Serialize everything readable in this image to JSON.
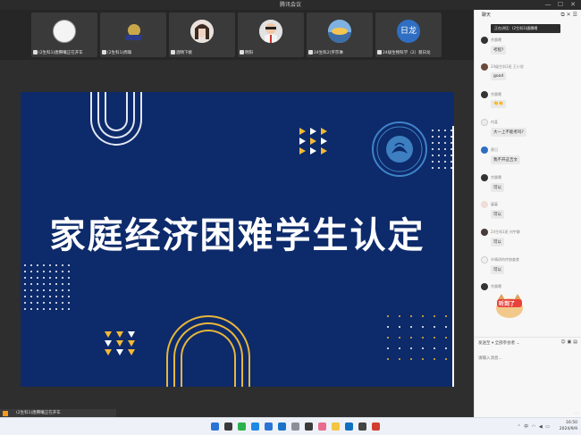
{
  "window": {
    "title": "腾讯会议",
    "minimize": "—",
    "maximize": "☐",
    "close": "✕"
  },
  "participants": [
    {
      "name": "(2生科1)唐腾曦正在开车",
      "avatar": "white-ball"
    },
    {
      "name": "(2生科1)周瑜",
      "avatar": "dog-photo"
    },
    {
      "name": "酒晴下桃",
      "avatar": "girl-photo"
    },
    {
      "name": "明阳",
      "avatar": "cartoon-man"
    },
    {
      "name": "24生科2)罗莎琳",
      "avatar": "scenery"
    },
    {
      "name": "24级生物科学（2）蔡日龙",
      "avatar": "text-avatar",
      "avatar_text": "日龙"
    }
  ],
  "slide": {
    "title": "家庭经济困难学生认定"
  },
  "bottom_status": {
    "label": "(2生科1)唐腾曦正在开车"
  },
  "chat": {
    "title": "聊天",
    "notice": "正在讲话：(2生科1)唐腾曦",
    "messages": [
      {
        "sender": "余晨曦",
        "text": "考程?"
      },
      {
        "sender": "24级生科1班 王小欣",
        "text": "good"
      },
      {
        "sender": "余晨曦",
        "text": "👏👏"
      },
      {
        "sender": "何某",
        "text": "大一上不能考吗?"
      },
      {
        "sender": "蔡日",
        "text": "我不开这吉文"
      },
      {
        "sender": "余晨曦",
        "text": "可以"
      },
      {
        "sender": "蔓蔓",
        "text": "可以"
      },
      {
        "sender": "24生科1班 刘宇静",
        "text": "可以"
      },
      {
        "sender": "许晴玥的传统美食",
        "text": "可以"
      },
      {
        "sender": "余晨曦",
        "sticker_text": "听到了"
      }
    ],
    "send_to_label": "发送至",
    "send_to_value": "全部参会者",
    "input_placeholder": "请输入消息...",
    "footer_hint": "⋯"
  },
  "taskbar": {
    "time": "16:50",
    "date": "2024/9/9",
    "lang": "中"
  }
}
